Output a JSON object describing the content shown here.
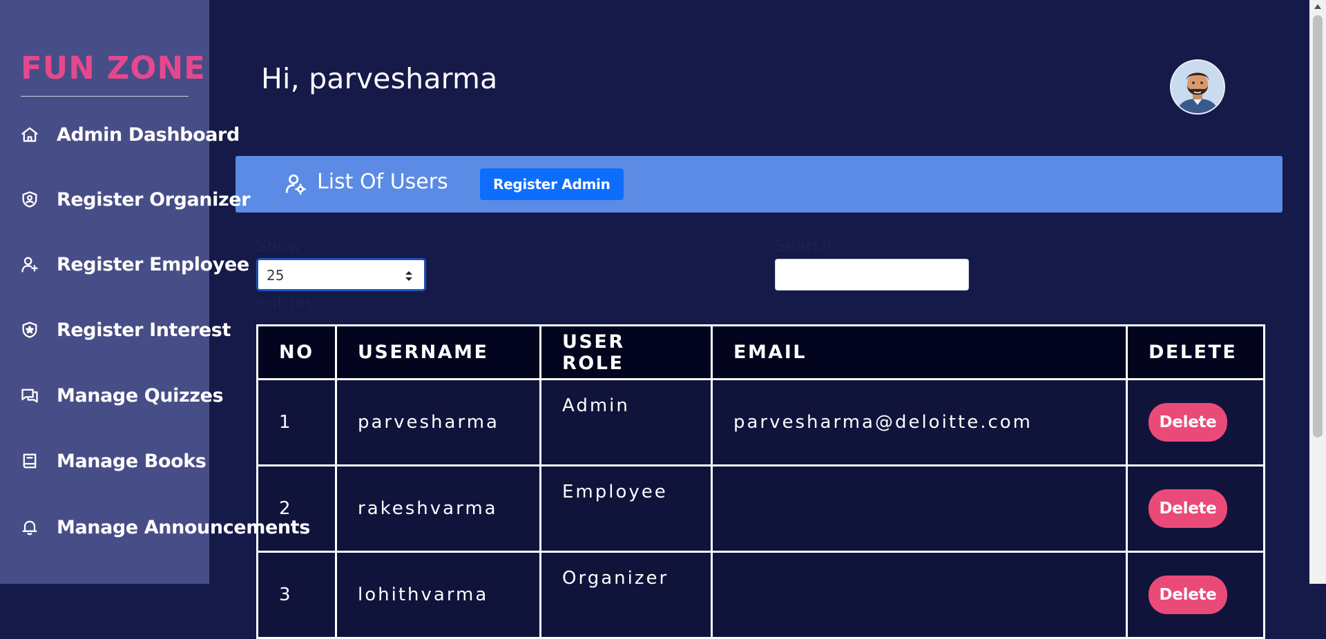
{
  "sidebar": {
    "brand": "FUN ZONE",
    "items": [
      {
        "label": "Admin Dashboard",
        "icon": "home-icon"
      },
      {
        "label": "Register Organizer",
        "icon": "user-shield-icon"
      },
      {
        "label": "Register Employee",
        "icon": "user-plus-icon"
      },
      {
        "label": "Register Interest",
        "icon": "star-shield-icon"
      },
      {
        "label": "Manage Quizzes",
        "icon": "chat-icon"
      },
      {
        "label": "Manage Books",
        "icon": "book-icon"
      },
      {
        "label": "Manage Announcements",
        "icon": "bell-icon"
      }
    ]
  },
  "header": {
    "greeting": "Hi, parvesharma",
    "avatar_icon": "avatar-icon"
  },
  "card": {
    "title": "List Of Users",
    "title_icon": "user-gear-icon",
    "register_button": "Register Admin"
  },
  "controls": {
    "show_label": "Show",
    "entries_value": "25",
    "entries_label": "entries",
    "search_label": "Search:",
    "search_value": ""
  },
  "table": {
    "columns": [
      "NO",
      "USERNAME",
      "USER ROLE",
      "EMAIL",
      "DELETE"
    ],
    "rows": [
      {
        "no": "1",
        "username": "parvesharma",
        "role": "Admin",
        "email": "parvesharma@deloitte.com",
        "action": "Delete"
      },
      {
        "no": "2",
        "username": "rakeshvarma",
        "role": "Employee",
        "email": "",
        "action": "Delete"
      },
      {
        "no": "3",
        "username": "lohithvarma",
        "role": "Organizer",
        "email": "",
        "action": "Delete"
      }
    ]
  },
  "colors": {
    "background": "#161a49",
    "sidebar": "#474d86",
    "brand": "#e5488d",
    "header_bar": "#5b8be4",
    "primary_button": "#0d6efd",
    "delete_button": "#ea4a78"
  }
}
